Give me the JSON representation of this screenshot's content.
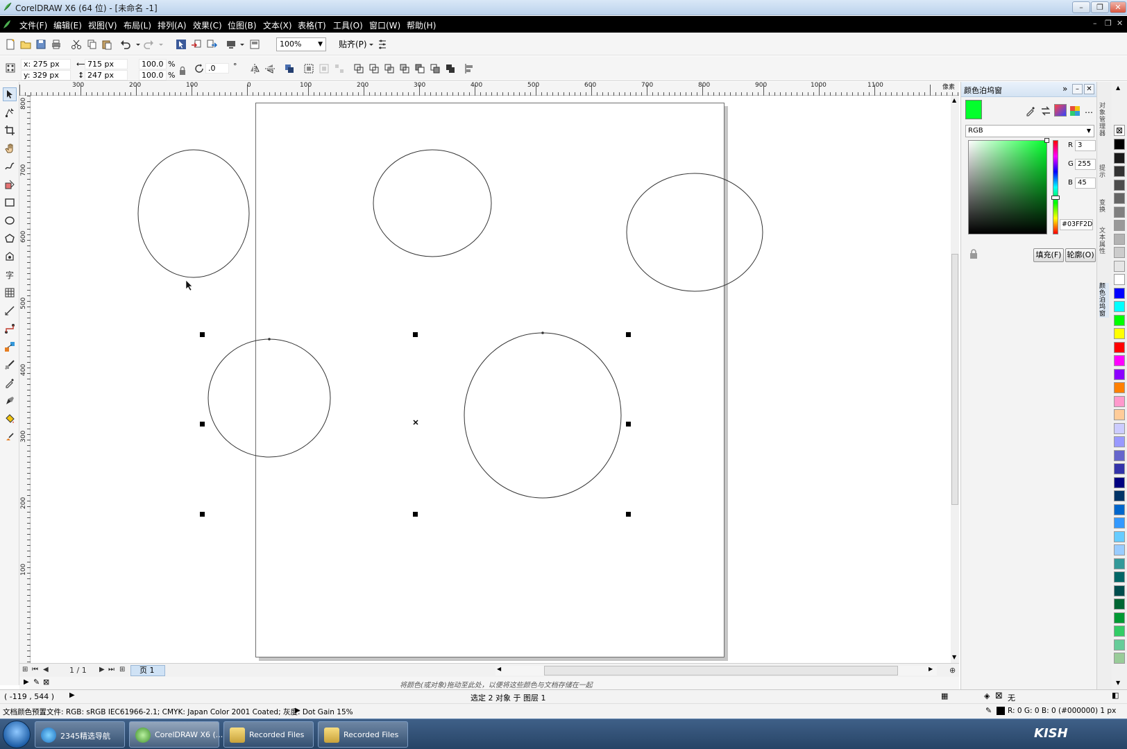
{
  "window": {
    "title": "CorelDRAW X6 (64 位) - [未命名 -1]",
    "minimize": "–",
    "maximize": "❐",
    "close": "✕"
  },
  "menu": [
    {
      "id": "file",
      "label": "文件(F)"
    },
    {
      "id": "edit",
      "label": "编辑(E)"
    },
    {
      "id": "view",
      "label": "视图(V)"
    },
    {
      "id": "layout",
      "label": "布局(L)"
    },
    {
      "id": "arrange",
      "label": "排列(A)"
    },
    {
      "id": "effects",
      "label": "效果(C)"
    },
    {
      "id": "bitmaps",
      "label": "位图(B)"
    },
    {
      "id": "text",
      "label": "文本(X)"
    },
    {
      "id": "table",
      "label": "表格(T)"
    },
    {
      "id": "tools",
      "label": "工具(O)"
    },
    {
      "id": "window",
      "label": "窗口(W)"
    },
    {
      "id": "help",
      "label": "帮助(H)"
    }
  ],
  "toolbar": {
    "zoom": "100%",
    "snap": "贴齐(P)"
  },
  "property_bar": {
    "x": "x: 275 px",
    "y": "y: 329 px",
    "width": "715 px",
    "height": "247 px",
    "scale_x": "100.0",
    "scale_y": "100.0",
    "percent": "%",
    "rotation": ".0",
    "degree": "°"
  },
  "rulers": {
    "h_labels": [
      "300",
      "200",
      "100",
      "0",
      "100",
      "200",
      "300",
      "400",
      "500",
      "600",
      "700",
      "800",
      "900",
      "1000",
      "1100"
    ],
    "h_unit": "像素",
    "v_labels": [
      "800",
      "700",
      "600",
      "500",
      "400",
      "300",
      "200",
      "100"
    ]
  },
  "docker": {
    "title": "颜色泊坞窗",
    "current_color": "#03FF2D",
    "model": "RGB",
    "r_label": "R",
    "r_value": "3",
    "g_label": "G",
    "g_value": "255",
    "b_label": "B",
    "b_value": "45",
    "hex": "#03FF2D",
    "fill_button": "填充(F)",
    "outline_button": "轮廓(O)"
  },
  "side_tabs": [
    "对象管理器",
    "提示",
    "变换",
    "文本属性",
    "颜色泊坞窗"
  ],
  "palette": [
    "#000000",
    "#1a1a1a",
    "#333333",
    "#4d4d4d",
    "#666666",
    "#808080",
    "#999999",
    "#b3b3b3",
    "#cccccc",
    "#e6e6e6",
    "#ffffff",
    "#0000ff",
    "#00ffff",
    "#00ff00",
    "#ffff00",
    "#ff0000",
    "#ff00ff",
    "#8b00ff",
    "#ff8000",
    "#ff99cc",
    "#ffcc99",
    "#ccccff",
    "#9999ff",
    "#6666cc",
    "#3333aa",
    "#000080",
    "#003366",
    "#0066cc",
    "#3399ff",
    "#66ccff",
    "#99ccff",
    "#339999",
    "#006666",
    "#004d4d",
    "#006633",
    "#009933",
    "#33cc66",
    "#66cc99",
    "#99cc99"
  ],
  "page_nav": {
    "counter": "1 / 1",
    "tab": "页 1"
  },
  "palette_hint": "将颜色(或对象)拖动至此处，以便将这些颜色与文档存储在一起",
  "status": {
    "cursor_coords": "( -119 , 544 )",
    "selection": "选定 2 对象 于 图层 1",
    "color_profile": "文档颜色预置文件: RGB: sRGB IEC61966-2.1; CMYK: Japan Color 2001 Coated; 灰度: Dot Gain 15%",
    "fill": "无",
    "outline": "R: 0 G: 0 B: 0 (#000000)  1 px"
  },
  "taskbar": {
    "items": [
      {
        "id": "browser",
        "label": "2345精选导航"
      },
      {
        "id": "corel",
        "label": "CorelDRAW X6 (..."
      },
      {
        "id": "rec1",
        "label": "Recorded Files"
      },
      {
        "id": "rec2",
        "label": "Recorded Files"
      }
    ],
    "brand": "KISH"
  }
}
